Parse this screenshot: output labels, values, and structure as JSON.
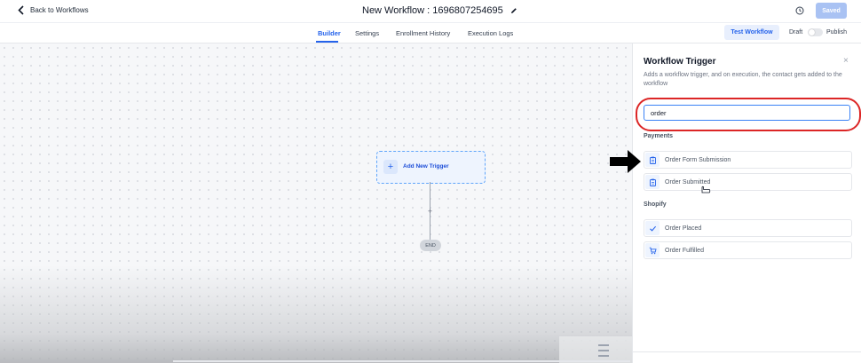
{
  "header": {
    "back_label": "Back to Workflows",
    "workflow_title": "New Workflow : 1696807254695",
    "saved_label": "Saved"
  },
  "tabs": [
    "Builder",
    "Settings",
    "Enrollment History",
    "Execution Logs"
  ],
  "active_tab": "Builder",
  "toolbar": {
    "test_label": "Test Workflow",
    "draft_label": "Draft",
    "publish_label": "Publish"
  },
  "canvas": {
    "trigger_label": "Add New Trigger",
    "add_step_symbol": "+",
    "end_label": "END"
  },
  "panel": {
    "title": "Workflow Trigger",
    "close_symbol": "×",
    "description": "Adds a workflow trigger, and on execution, the contact gets added to the workflow",
    "search_value": "order",
    "sections": [
      {
        "name": "Payments",
        "items": [
          {
            "label": "Order Form Submission",
            "icon": "clipboard-icon"
          },
          {
            "label": "Order Submitted",
            "icon": "clipboard-icon"
          }
        ]
      },
      {
        "name": "Shopify",
        "items": [
          {
            "label": "Order Placed",
            "icon": "check-icon"
          },
          {
            "label": "Order Fulfilled",
            "icon": "cart-icon"
          }
        ]
      }
    ]
  },
  "colors": {
    "accent": "#2563eb",
    "highlight_ring": "#dc2626",
    "saved_button": "#a9c2f3"
  }
}
